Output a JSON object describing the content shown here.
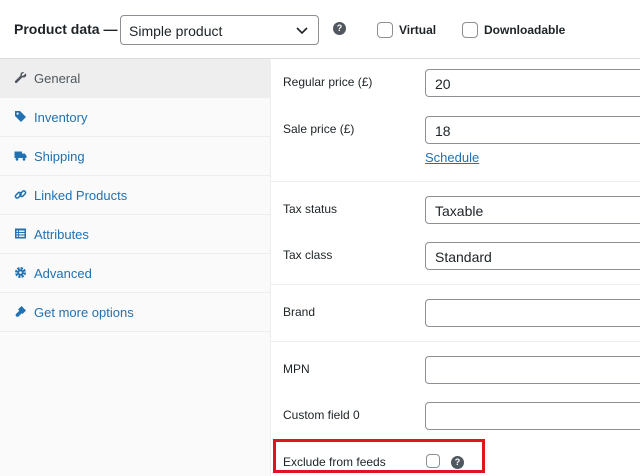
{
  "header": {
    "title": "Product data —",
    "product_type": "Simple product",
    "virtual_label": "Virtual",
    "downloadable_label": "Downloadable",
    "help_symbol": "?"
  },
  "tabs": [
    {
      "label": "General",
      "icon": "wrench-icon",
      "active": true
    },
    {
      "label": "Inventory",
      "icon": "tag-icon",
      "active": false
    },
    {
      "label": "Shipping",
      "icon": "truck-icon",
      "active": false
    },
    {
      "label": "Linked Products",
      "icon": "link-icon",
      "active": false
    },
    {
      "label": "Attributes",
      "icon": "list-icon",
      "active": false
    },
    {
      "label": "Advanced",
      "icon": "gear-icon",
      "active": false
    },
    {
      "label": "Get more options",
      "icon": "plugin-icon",
      "active": false
    }
  ],
  "fields": {
    "regular_price": {
      "label": "Regular price (£)",
      "value": "20"
    },
    "sale_price": {
      "label": "Sale price (£)",
      "value": "18"
    },
    "schedule_link": "Schedule",
    "tax_status": {
      "label": "Tax status",
      "value": "Taxable"
    },
    "tax_class": {
      "label": "Tax class",
      "value": "Standard"
    },
    "brand": {
      "label": "Brand",
      "value": ""
    },
    "mpn": {
      "label": "MPN",
      "value": ""
    },
    "custom_field_0": {
      "label": "Custom field 0",
      "value": ""
    },
    "exclude_from_feeds": {
      "label": "Exclude from feeds",
      "checked": false
    }
  },
  "colors": {
    "link": "#2271b1",
    "highlight": "#e0141e",
    "active_tab_bg": "#eeeeee"
  }
}
